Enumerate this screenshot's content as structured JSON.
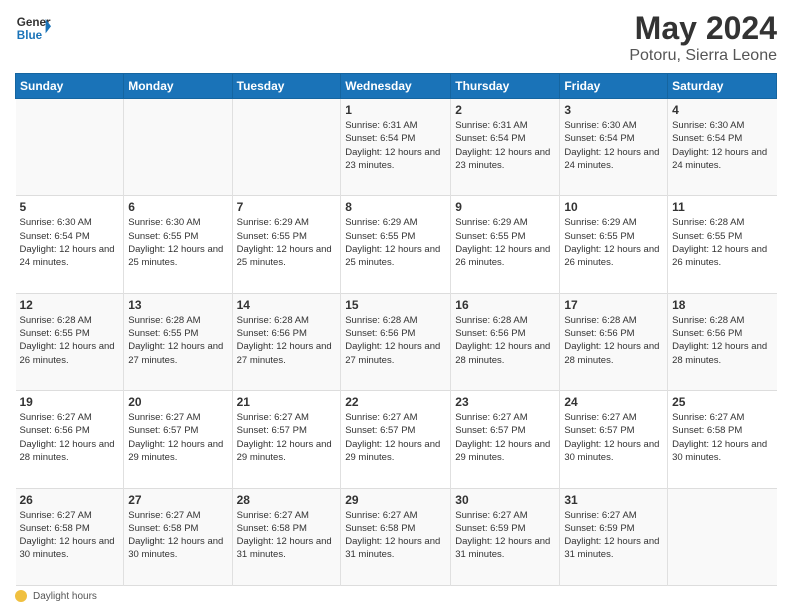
{
  "header": {
    "logo_line1": "General",
    "logo_line2": "Blue",
    "main_title": "May 2024",
    "subtitle": "Potoru, Sierra Leone"
  },
  "weekdays": [
    "Sunday",
    "Monday",
    "Tuesday",
    "Wednesday",
    "Thursday",
    "Friday",
    "Saturday"
  ],
  "footer_label": "Daylight hours",
  "weeks": [
    [
      {
        "num": "",
        "info": ""
      },
      {
        "num": "",
        "info": ""
      },
      {
        "num": "",
        "info": ""
      },
      {
        "num": "1",
        "info": "Sunrise: 6:31 AM\nSunset: 6:54 PM\nDaylight: 12 hours and 23 minutes."
      },
      {
        "num": "2",
        "info": "Sunrise: 6:31 AM\nSunset: 6:54 PM\nDaylight: 12 hours and 23 minutes."
      },
      {
        "num": "3",
        "info": "Sunrise: 6:30 AM\nSunset: 6:54 PM\nDaylight: 12 hours and 24 minutes."
      },
      {
        "num": "4",
        "info": "Sunrise: 6:30 AM\nSunset: 6:54 PM\nDaylight: 12 hours and 24 minutes."
      }
    ],
    [
      {
        "num": "5",
        "info": "Sunrise: 6:30 AM\nSunset: 6:54 PM\nDaylight: 12 hours and 24 minutes."
      },
      {
        "num": "6",
        "info": "Sunrise: 6:30 AM\nSunset: 6:55 PM\nDaylight: 12 hours and 25 minutes."
      },
      {
        "num": "7",
        "info": "Sunrise: 6:29 AM\nSunset: 6:55 PM\nDaylight: 12 hours and 25 minutes."
      },
      {
        "num": "8",
        "info": "Sunrise: 6:29 AM\nSunset: 6:55 PM\nDaylight: 12 hours and 25 minutes."
      },
      {
        "num": "9",
        "info": "Sunrise: 6:29 AM\nSunset: 6:55 PM\nDaylight: 12 hours and 26 minutes."
      },
      {
        "num": "10",
        "info": "Sunrise: 6:29 AM\nSunset: 6:55 PM\nDaylight: 12 hours and 26 minutes."
      },
      {
        "num": "11",
        "info": "Sunrise: 6:28 AM\nSunset: 6:55 PM\nDaylight: 12 hours and 26 minutes."
      }
    ],
    [
      {
        "num": "12",
        "info": "Sunrise: 6:28 AM\nSunset: 6:55 PM\nDaylight: 12 hours and 26 minutes."
      },
      {
        "num": "13",
        "info": "Sunrise: 6:28 AM\nSunset: 6:55 PM\nDaylight: 12 hours and 27 minutes."
      },
      {
        "num": "14",
        "info": "Sunrise: 6:28 AM\nSunset: 6:56 PM\nDaylight: 12 hours and 27 minutes."
      },
      {
        "num": "15",
        "info": "Sunrise: 6:28 AM\nSunset: 6:56 PM\nDaylight: 12 hours and 27 minutes."
      },
      {
        "num": "16",
        "info": "Sunrise: 6:28 AM\nSunset: 6:56 PM\nDaylight: 12 hours and 28 minutes."
      },
      {
        "num": "17",
        "info": "Sunrise: 6:28 AM\nSunset: 6:56 PM\nDaylight: 12 hours and 28 minutes."
      },
      {
        "num": "18",
        "info": "Sunrise: 6:28 AM\nSunset: 6:56 PM\nDaylight: 12 hours and 28 minutes."
      }
    ],
    [
      {
        "num": "19",
        "info": "Sunrise: 6:27 AM\nSunset: 6:56 PM\nDaylight: 12 hours and 28 minutes."
      },
      {
        "num": "20",
        "info": "Sunrise: 6:27 AM\nSunset: 6:57 PM\nDaylight: 12 hours and 29 minutes."
      },
      {
        "num": "21",
        "info": "Sunrise: 6:27 AM\nSunset: 6:57 PM\nDaylight: 12 hours and 29 minutes."
      },
      {
        "num": "22",
        "info": "Sunrise: 6:27 AM\nSunset: 6:57 PM\nDaylight: 12 hours and 29 minutes."
      },
      {
        "num": "23",
        "info": "Sunrise: 6:27 AM\nSunset: 6:57 PM\nDaylight: 12 hours and 29 minutes."
      },
      {
        "num": "24",
        "info": "Sunrise: 6:27 AM\nSunset: 6:57 PM\nDaylight: 12 hours and 30 minutes."
      },
      {
        "num": "25",
        "info": "Sunrise: 6:27 AM\nSunset: 6:58 PM\nDaylight: 12 hours and 30 minutes."
      }
    ],
    [
      {
        "num": "26",
        "info": "Sunrise: 6:27 AM\nSunset: 6:58 PM\nDaylight: 12 hours and 30 minutes."
      },
      {
        "num": "27",
        "info": "Sunrise: 6:27 AM\nSunset: 6:58 PM\nDaylight: 12 hours and 30 minutes."
      },
      {
        "num": "28",
        "info": "Sunrise: 6:27 AM\nSunset: 6:58 PM\nDaylight: 12 hours and 31 minutes."
      },
      {
        "num": "29",
        "info": "Sunrise: 6:27 AM\nSunset: 6:58 PM\nDaylight: 12 hours and 31 minutes."
      },
      {
        "num": "30",
        "info": "Sunrise: 6:27 AM\nSunset: 6:59 PM\nDaylight: 12 hours and 31 minutes."
      },
      {
        "num": "31",
        "info": "Sunrise: 6:27 AM\nSunset: 6:59 PM\nDaylight: 12 hours and 31 minutes."
      },
      {
        "num": "",
        "info": ""
      }
    ]
  ]
}
